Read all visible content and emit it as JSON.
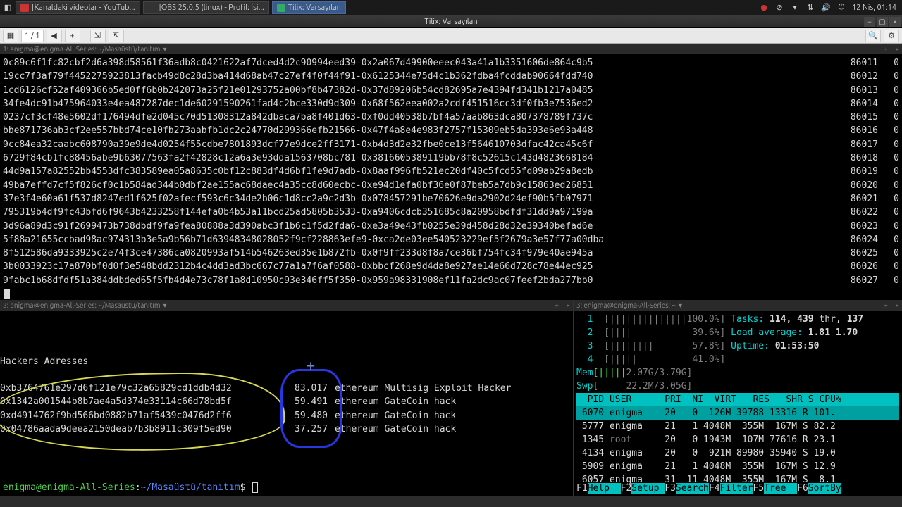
{
  "taskbar": {
    "apps": [
      {
        "label": "[Kanaldaki videolar - YouTub..."
      },
      {
        "label": "[OBS 25.0.5 (linux) - Profil: İsi..."
      },
      {
        "label": "Tilix: Varsayılan"
      }
    ],
    "clock": "12 Nis, 01:14"
  },
  "window": {
    "title": "Tilix: Varsayılan",
    "counter": "1 / 1"
  },
  "tabs": {
    "top": "1: enigma@enigma-All-Series: ~/Masaüstü/tanıtım",
    "left": "2: enigma@enigma-All-Series: ~/Masaüstü/tanıtım",
    "right": "3: enigma@enigma-All-Series: ~"
  },
  "top_rows": [
    {
      "h": "0c89c6f1fc82cbf2d6a398d58561f36adb8c0421622af7dced4d2c90994eed39-0x2a067d49900eeec043a41a1b3351606de864c9b5",
      "n": "86011",
      "z": "0"
    },
    {
      "h": "19cc7f3af79f4452275923813facb49d8c28d3ba414d68ab47c27ef4f0f44f91-0x6125344e75d4c1b362fdba4fcddab90664fdd740",
      "n": "86012",
      "z": "0"
    },
    {
      "h": "1cd6126cf52af409366b5ed0ff6b0b242073a25f21e01293752a00bf8b47382d-0x37d89206b54cd82695a7e4394fd341b1217a0485",
      "n": "86013",
      "z": "0"
    },
    {
      "h": "34fe4dc91b475964033e4ea487287dec1de60291590261fad4c2bce330d9d309-0x68f562eea002a2cdf451516cc3df0fb3e7536ed2",
      "n": "86014",
      "z": "0"
    },
    {
      "h": "0237cf3cf48e5602df176494dfe2d045c70d51308312a842dbaca7ba8f401d63-0xf0dd40538b7bf4a57aab863dca807378789f737c",
      "n": "86015",
      "z": "0"
    },
    {
      "h": "bbe871736ab3cf2ee557bbd74ce10fb273aabfb1dc2c24770d299366efb21566-0x47f4a8e4e983f2757f15309eb5da393e6e93a448",
      "n": "86016",
      "z": "0"
    },
    {
      "h": "9cc84ea32caabc608790a39e9de4d0254f55cdbe7801893dcf77e9dce2ff3171-0xb4d3d2e32fbe0ce13f564610703dfac42ca45c6f",
      "n": "86017",
      "z": "0"
    },
    {
      "h": "6729f84cb1fc88456abe9b63077563fa2f42828c12a6a3e93dda1563708bc781-0x3816605389119bb78f8c52615c143d4823668184",
      "n": "86018",
      "z": "0"
    },
    {
      "h": "44d9a157a82552bb4553dfc383589ea05a8635c0bf12c883df4d6bf1fe9d7adb-0x8aaf996fb521ec20df40c5fcd55fd09ab29a8edb",
      "n": "86019",
      "z": "0"
    },
    {
      "h": "49ba7effd7cf5f826cf0c1b584ad344b0dbf2ae155ac68daec4a35cc8d60ecbc-0xe94d1efa0bf36e0f87beb5a7db9c15863ed26851",
      "n": "86020",
      "z": "0"
    },
    {
      "h": "37e3f4e60a61f537d8247ed1f625f02afecf593c6c34de2b06c1d8cc2a9c2d3b-0x078457291be70626e9da2902d24ef90b5fb07971",
      "n": "86021",
      "z": "0"
    },
    {
      "h": "795319b4df9fc43bfd6f9643b4233258f144efa0b4b53a11bcd25ad5805b3533-0xa9406cdcb351685c8a20958bdfdf31dd9a97199a",
      "n": "86022",
      "z": "0"
    },
    {
      "h": "3d96a89d3c91f2699473b738dbdf9fa9fea80888a3d390abc3f1b6c1f5d2fda6-0xe3a49e43fb0255e39d458d28d32e39340befad6e",
      "n": "86023",
      "z": "0"
    },
    {
      "h": "5f88a21655ccbad98ac974313b3e5a9b56b71d63948348028052f9cf228863efe9-0xca2de03ee540523229ef5f2679a3e57f77a00dba",
      "n": "86024",
      "z": "0"
    },
    {
      "h": "8f512586da9333925c2e74f3ce47386ca0820993af514b546263ed35e1b872fb-0x0f9ff233d8f8a7ce36bf754fc34f979e40ae945a",
      "n": "86025",
      "z": "0"
    },
    {
      "h": "3b0033923c17a870bf0d0f3e548bdd2312b4c4dd3ad3bc667c77a1a7f6af0588-0xbbcf268e9d4da8e927ae14e66d728c78e44ec925",
      "n": "86026",
      "z": "0"
    },
    {
      "h": "9fabc1b68dfdf51a384ddbded65f5fb4d4e73c78f1a8d10950c93e346ff5f350-0x959a98331908ef11fa2dc9ac07feef2bda277bb0",
      "n": "86027",
      "z": "0"
    }
  ],
  "hackers": {
    "title": "Hackers Adresses",
    "rows": [
      {
        "addr": "0xb3764761e297d6f121e79c32a65829cd1ddb4d32",
        "val": "83.017",
        "desc": "ethereum Multisig Exploit Hacker"
      },
      {
        "addr": "0x1342a001544b8b7ae4a5d374e33114c66d78bd5f",
        "val": "59.491",
        "desc": "ethereum GateCoin hack"
      },
      {
        "addr": "0xd4914762f9bd566bd0882b71af5439c0476d2ff6",
        "val": "59.480",
        "desc": "ethereum GateCoin hack"
      },
      {
        "addr": "0x04786aada9deea2150deab7b3b8911c309f5ed90",
        "val": "37.257",
        "desc": "ethereum GateCoin hack"
      }
    ]
  },
  "prompt": {
    "userhost": "enigma@enigma-All-Series",
    "path": "~/Masaüstü/tanıtım",
    "sep1": ":",
    "sep2": "$"
  },
  "htop": {
    "cpu": [
      {
        "n": "1",
        "bar": "[||||||||||||||",
        "pct": "100.0%",
        "end": "]"
      },
      {
        "n": "2",
        "bar": "[||||          ",
        "pct": " 39.6%",
        "end": "]"
      },
      {
        "n": "3",
        "bar": "[||||||||      ",
        "pct": " 57.8%",
        "end": "]"
      },
      {
        "n": "4",
        "bar": "[|||||         ",
        "pct": " 41.0%",
        "end": "]"
      }
    ],
    "mem": {
      "label": "Mem",
      "bar": "[|||||",
      "val": "2.07G/3.79G",
      "end": "]"
    },
    "swp": {
      "label": "Swp",
      "bar": "[     ",
      "val": "22.2M/3.05G",
      "end": "]"
    },
    "tasks_label": "Tasks:",
    "tasks": "114,",
    "thr": "439",
    "thr_label": "thr,",
    "tasks2": "137",
    "load_label": "Load average:",
    "load": "1.81 1.70",
    "uptime_label": "Uptime:",
    "uptime": "01:53:50",
    "header": "  PID USER      PRI  NI  VIRT   RES   SHR S CPU%",
    "procs": [
      {
        "pid": " 6070",
        "user": "enigma",
        "pri": "20",
        "ni": "  0",
        "virt": " 126M",
        "res": "39788",
        "shr": "13316",
        "s": "R",
        "cpu": "101."
      },
      {
        "pid": " 5777",
        "user": "enigma",
        "pri": "21",
        "ni": "  1",
        "virt": "4048M",
        "res": " 355M",
        "shr": " 167M",
        "s": "S",
        "cpu": "82.2"
      },
      {
        "pid": " 1345",
        "user": "root",
        "pri": "20",
        "ni": "  0",
        "virt": "1943M",
        "res": " 107M",
        "shr": "77616",
        "s": "R",
        "cpu": "23.1"
      },
      {
        "pid": " 4134",
        "user": "enigma",
        "pri": "20",
        "ni": "  0",
        "virt": " 921M",
        "res": "89980",
        "shr": "35940",
        "s": "S",
        "cpu": "19.0"
      },
      {
        "pid": " 5909",
        "user": "enigma",
        "pri": "21",
        "ni": "  1",
        "virt": "4048M",
        "res": " 355M",
        "shr": " 167M",
        "s": "S",
        "cpu": "12.9"
      },
      {
        "pid": " 6057",
        "user": "enigma",
        "pri": "31",
        "ni": " 11",
        "virt": "4048M",
        "res": " 355M",
        "shr": " 167M",
        "s": "S",
        "cpu": " 8.1"
      }
    ],
    "fkeys": [
      {
        "k": "F1",
        "l": "Help  "
      },
      {
        "k": "F2",
        "l": "Setup "
      },
      {
        "k": "F3",
        "l": "Search"
      },
      {
        "k": "F4",
        "l": "Filter"
      },
      {
        "k": "F5",
        "l": "Tree  "
      },
      {
        "k": "F6",
        "l": "SortBy"
      }
    ]
  }
}
